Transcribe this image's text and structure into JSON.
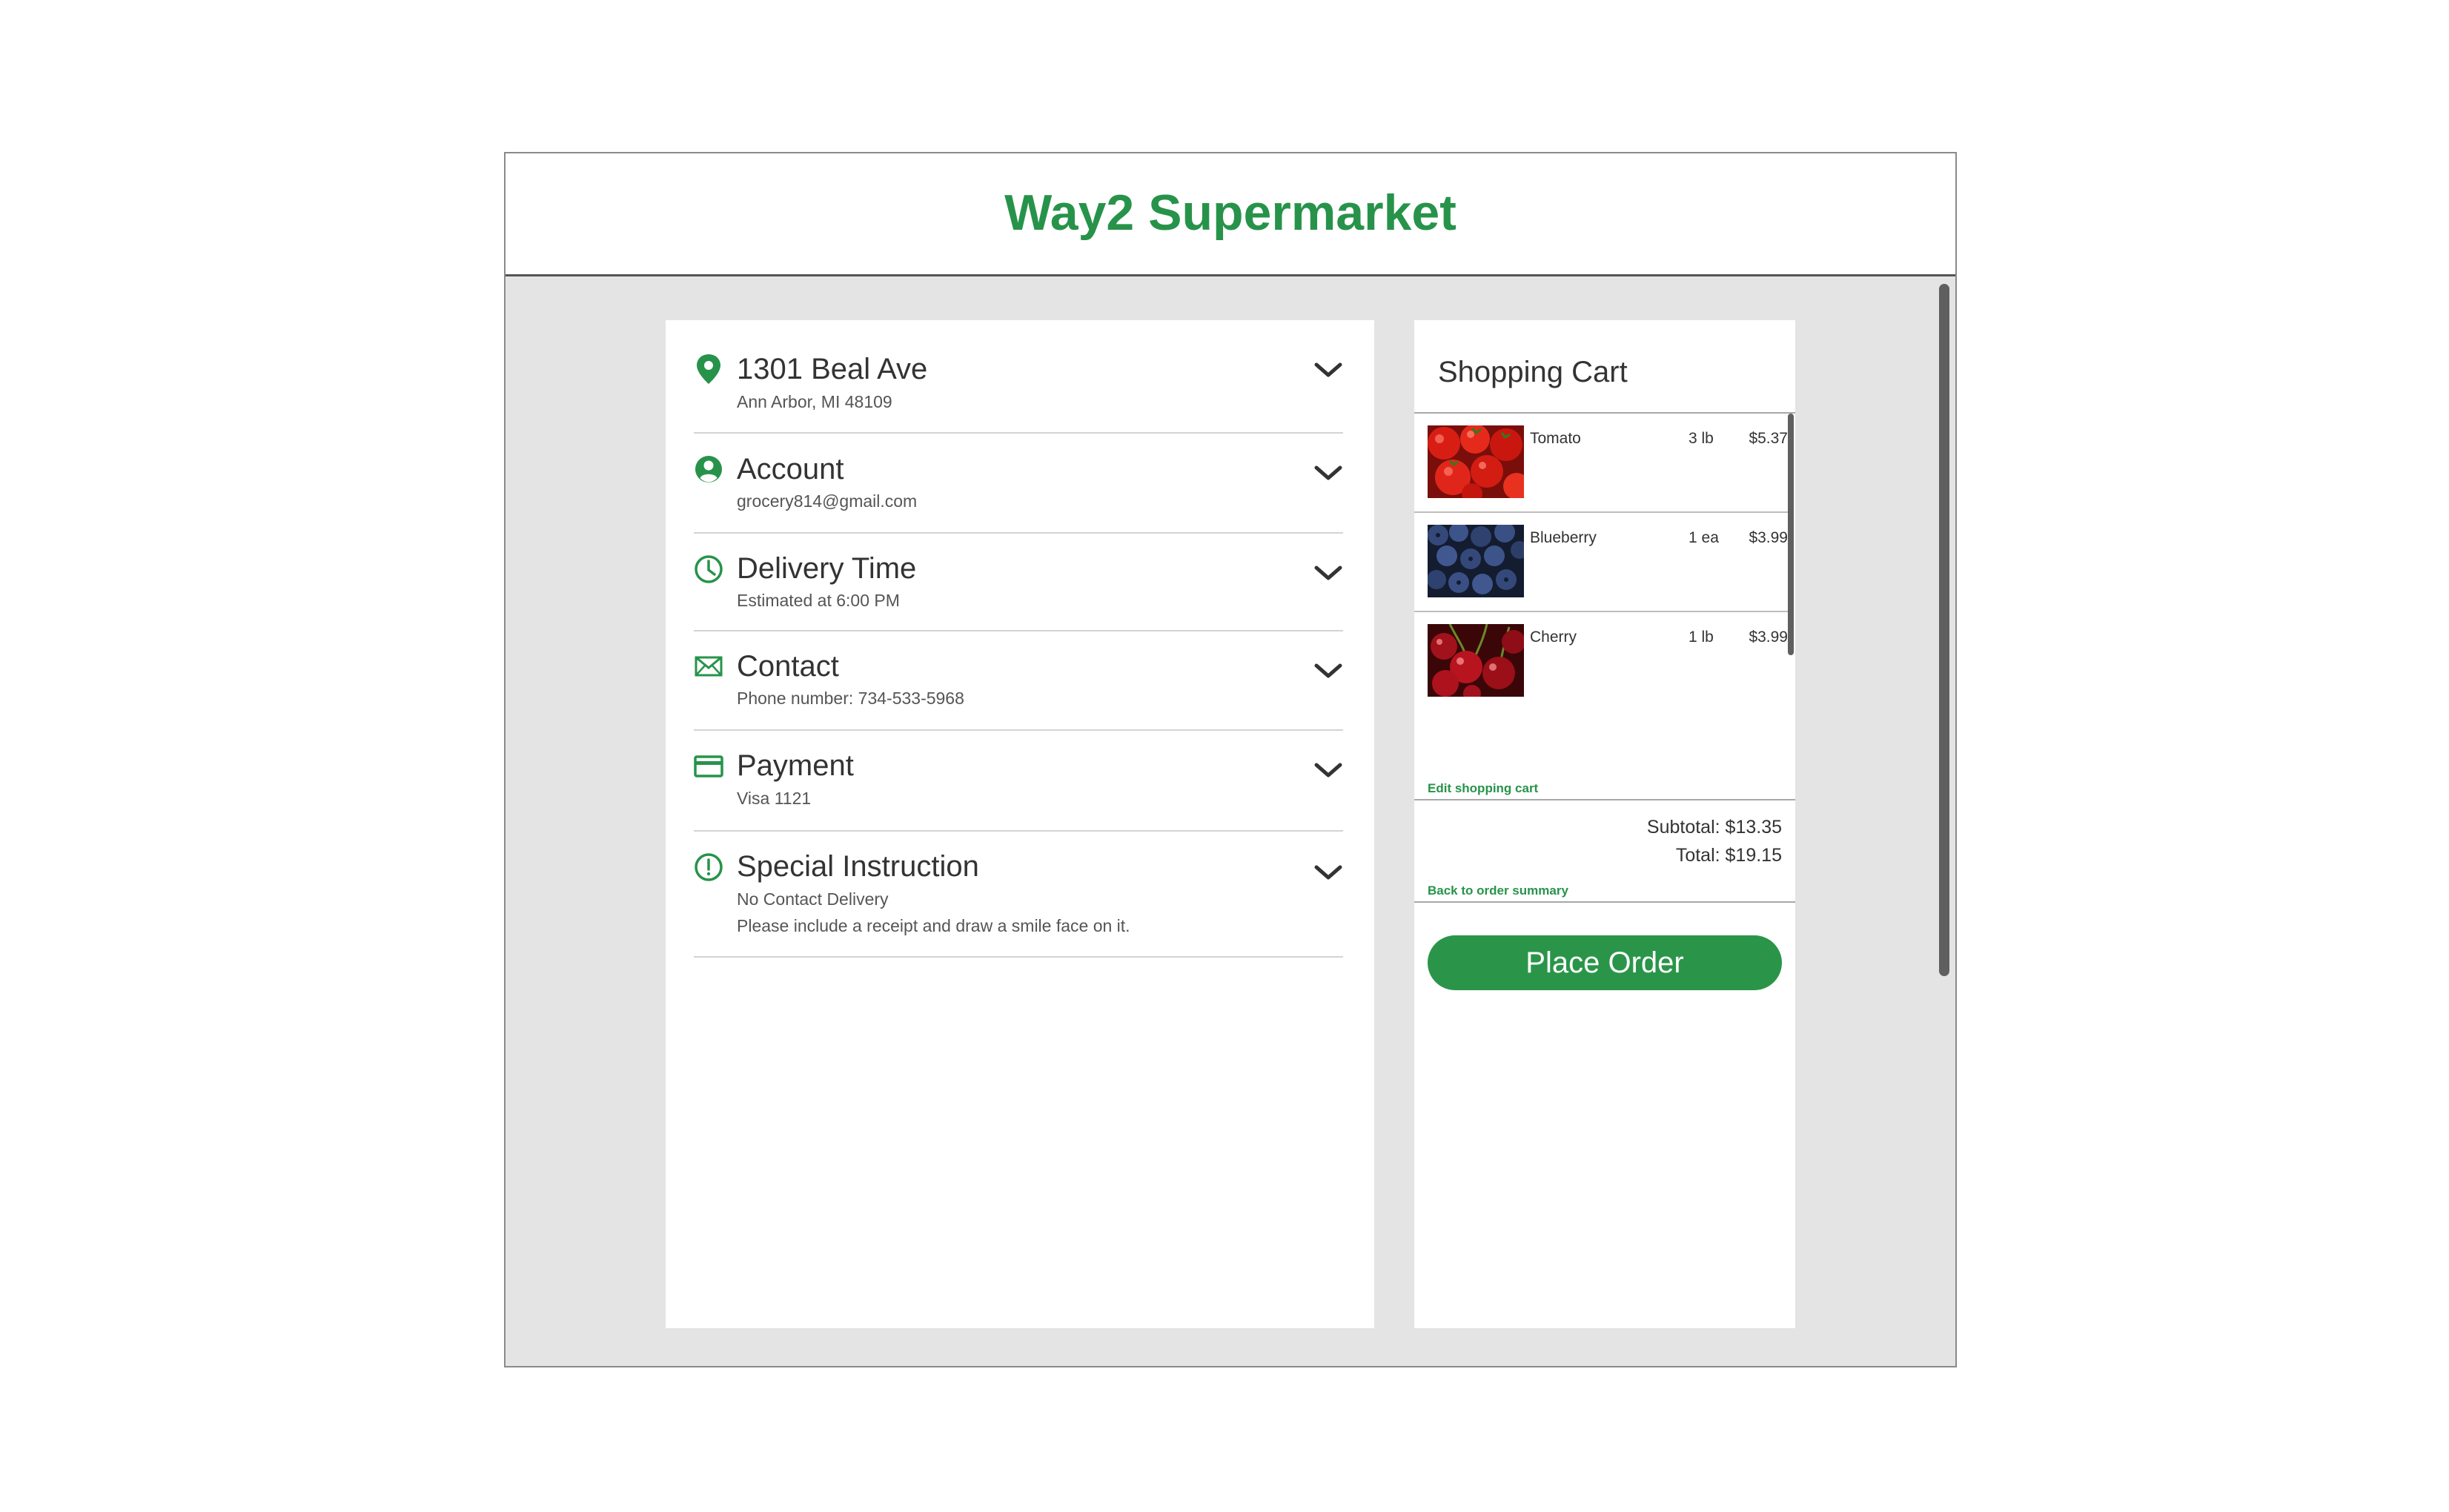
{
  "app": {
    "title": "Way2 Supermarket"
  },
  "checkout": {
    "sections": [
      {
        "icon": "map-pin-icon",
        "title": "1301 Beal Ave",
        "subtitle": "Ann Arbor, MI 48109"
      },
      {
        "icon": "account-icon",
        "title": "Account",
        "subtitle": "grocery814@gmail.com"
      },
      {
        "icon": "clock-icon",
        "title": "Delivery Time",
        "subtitle": "Estimated at 6:00 PM"
      },
      {
        "icon": "mail-icon",
        "title": "Contact",
        "subtitle": "Phone number: 734-533-5968"
      },
      {
        "icon": "credit-card-icon",
        "title": "Payment",
        "subtitle": "Visa 1121"
      },
      {
        "icon": "alert-circle-icon",
        "title": "Special Instruction",
        "subtitle": "No Contact Delivery",
        "note": "Please include a receipt and draw a smile face on it."
      }
    ]
  },
  "cart": {
    "title": "Shopping Cart",
    "items": [
      {
        "name": "Tomato",
        "qty": "3 lb",
        "price": "$5.37"
      },
      {
        "name": "Blueberry",
        "qty": "1 ea",
        "price": "$3.99"
      },
      {
        "name": "Cherry",
        "qty": "1 lb",
        "price": "$3.99"
      }
    ],
    "edit_link": "Edit shopping cart",
    "subtotal": "Subtotal: $13.35",
    "total": "Total: $19.15",
    "back_link": "Back to order summary",
    "place_order": "Place Order"
  },
  "colors": {
    "brand_green": "#27934a",
    "button_green": "#2a9549",
    "background": "#e4e4e4"
  }
}
